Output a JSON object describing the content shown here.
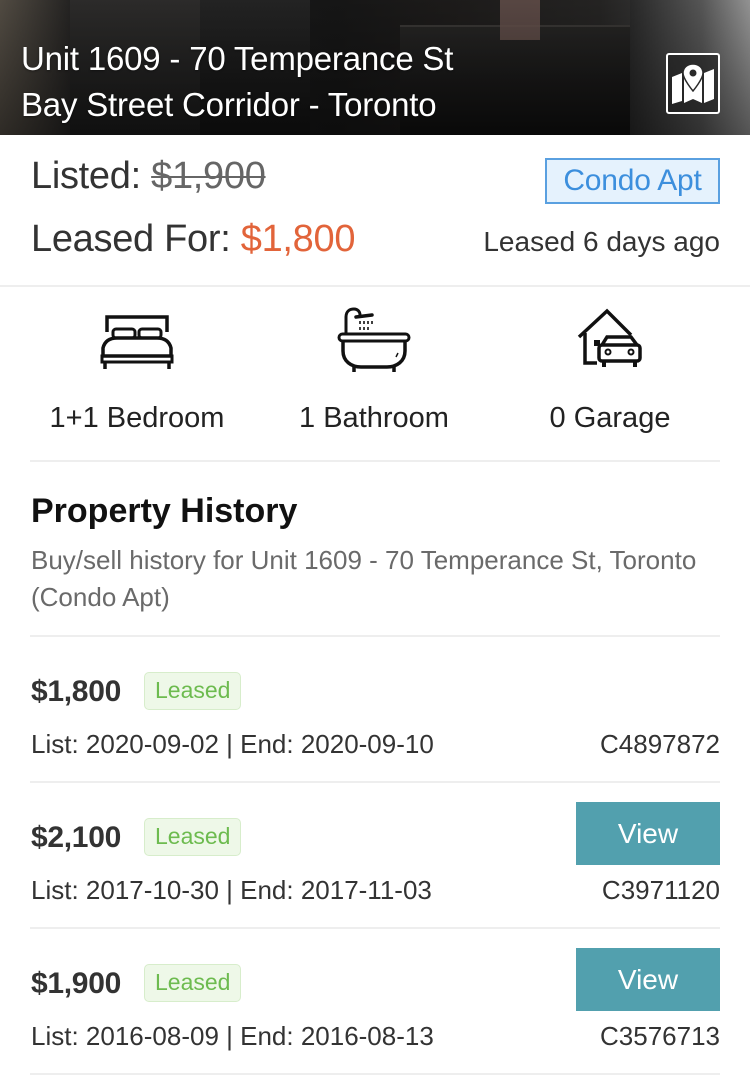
{
  "header": {
    "address_line1": "Unit 1609 - 70 Temperance St",
    "address_line2": "Bay Street Corridor - Toronto",
    "map_button_icon": "map-pin-icon"
  },
  "pricing": {
    "listed_label": "Listed:",
    "listed_price": "$1,900",
    "leased_label": "Leased For:",
    "leased_price": "$1,800",
    "property_type": "Condo Apt",
    "leased_ago": "Leased 6 days ago",
    "colors": {
      "leased_price": "#e2643a",
      "badge_text": "#3c8fdd",
      "badge_bg": "#e5f2fd"
    }
  },
  "features": [
    {
      "icon": "bed-icon",
      "label": "1+1 Bedroom"
    },
    {
      "icon": "bathtub-icon",
      "label": "1 Bathroom"
    },
    {
      "icon": "garage-icon",
      "label": "0 Garage"
    }
  ],
  "history": {
    "title": "Property History",
    "subtitle": "Buy/sell history for Unit 1609 - 70 Temperance St, Toronto (Condo Apt)",
    "view_label": "View",
    "colors": {
      "status_text": "#6dbb4f",
      "status_bg": "#eef8e8",
      "view_bg": "#52a0ae"
    },
    "rows": [
      {
        "price": "$1,800",
        "status": "Leased",
        "dates": "List: 2020-09-02 | End: 2020-09-10",
        "mls": "C4897872",
        "has_view": false
      },
      {
        "price": "$2,100",
        "status": "Leased",
        "dates": "List: 2017-10-30 | End: 2017-11-03",
        "mls": "C3971120",
        "has_view": true
      },
      {
        "price": "$1,900",
        "status": "Leased",
        "dates": "List: 2016-08-09 | End: 2016-08-13",
        "mls": "C3576713",
        "has_view": true
      }
    ]
  }
}
